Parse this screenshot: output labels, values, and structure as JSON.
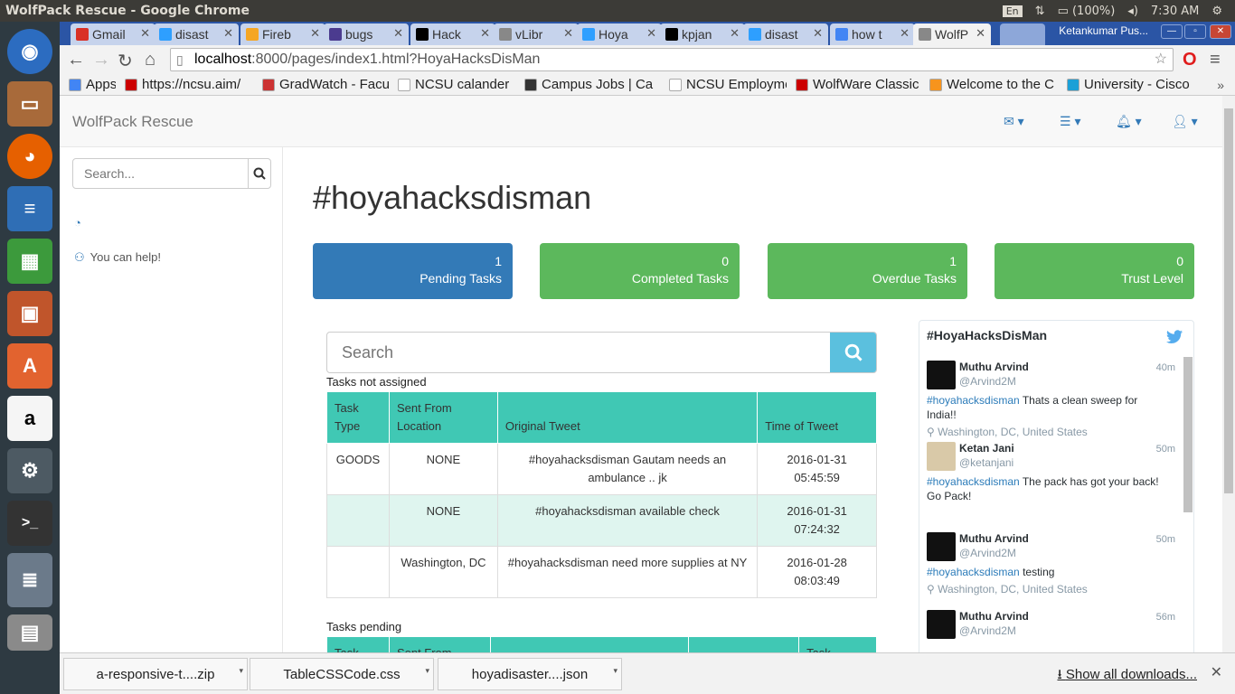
{
  "os": {
    "window_title": "WolfPack Rescue - Google Chrome",
    "keyboard": "En",
    "battery": "(100%)",
    "clock": "7:30 AM"
  },
  "browser": {
    "tabs": [
      {
        "label": "Gmail",
        "icon": "gmail-icon",
        "color": "#d93025"
      },
      {
        "label": "disast",
        "icon": "disqus-icon",
        "color": "#2e9fff"
      },
      {
        "label": "Fireb",
        "icon": "firebase-icon",
        "color": "#f5a623"
      },
      {
        "label": "bugs",
        "icon": "bugs-icon",
        "color": "#4b3b8f"
      },
      {
        "label": "Hack",
        "icon": "github-icon",
        "color": "#000000"
      },
      {
        "label": "vLibr",
        "icon": "page-icon",
        "color": "#888888"
      },
      {
        "label": "Hoya",
        "icon": "disqus-icon",
        "color": "#2e9fff"
      },
      {
        "label": "kpjan",
        "icon": "github-icon",
        "color": "#000000"
      },
      {
        "label": "disast",
        "icon": "disqus-icon",
        "color": "#2e9fff"
      },
      {
        "label": "how t",
        "icon": "google-icon",
        "color": "#4285f4"
      },
      {
        "label": "WolfP",
        "icon": "page-icon",
        "color": "#888888"
      }
    ],
    "profile_name": "Ketankumar Pus...",
    "url_host": "localhost",
    "url_rest": ":8000/pages/index1.html?HoyaHacksDisMan",
    "bookmarks": [
      {
        "label": "Apps",
        "color": "#4285f4"
      },
      {
        "label": "https://ncsu.aim/",
        "color": "#cc0000"
      },
      {
        "label": "GradWatch - Facu",
        "color": "#cc3333"
      },
      {
        "label": "NCSU calander",
        "color": "#ffffff"
      },
      {
        "label": "Campus Jobs | Ca",
        "color": "#333333"
      },
      {
        "label": "NCSU Employme",
        "color": "#ffffff"
      },
      {
        "label": "WolfWare Classic",
        "color": "#cc0000"
      },
      {
        "label": "Welcome to the C",
        "color": "#f7941d"
      },
      {
        "label": "University - Cisco",
        "color": "#1ba0d7"
      }
    ]
  },
  "app": {
    "brand": "WolfPack Rescue",
    "sidebar": {
      "search_placeholder": "Search...",
      "items": [
        {
          "label": "",
          "icon": "dashboard-icon"
        },
        {
          "label": "You can help!",
          "icon": "group-icon"
        }
      ]
    },
    "page_title": "#hoyahacksdisman",
    "panels": [
      {
        "value": "1",
        "label": "Pending Tasks",
        "color": "#337ab7"
      },
      {
        "value": "0",
        "label": "Completed Tasks",
        "color": "#5cb85c"
      },
      {
        "value": "1",
        "label": "Overdue Tasks",
        "color": "#5cb85c"
      },
      {
        "value": "0",
        "label": "Trust Level",
        "color": "#5cb85c"
      }
    ],
    "task_search_placeholder": "Search",
    "unassigned": {
      "caption": "Tasks not assigned",
      "headers": [
        "Task Type",
        "Sent From Location",
        "Original Tweet",
        "Time of Tweet"
      ],
      "rows": [
        [
          "GOODS",
          "NONE",
          "#hoyahacksdisman Gautam needs an ambulance .. jk",
          "2016-01-31 05:45:59"
        ],
        [
          "",
          "NONE",
          "#hoyahacksdisman available check",
          "2016-01-31 07:24:32"
        ],
        [
          "",
          "Washington, DC",
          "#hoyahacksdisman need more supplies at NY",
          "2016-01-28 08:03:49"
        ]
      ]
    },
    "pending": {
      "caption": "Tasks pending",
      "headers": [
        "Task",
        "Sent From",
        "",
        "",
        "Task"
      ]
    },
    "twitter": {
      "title": "#HoyaHacksDisMan",
      "tweets": [
        {
          "name": "Muthu Arvind",
          "handle": "@Arvind2M",
          "time": "40m",
          "hashtag": "#hoyahacksdisman",
          "text": " Thats a clean sweep for India!!",
          "location": "Washington, DC, United States"
        },
        {
          "name": "Ketan Jani",
          "handle": "@ketanjani",
          "time": "50m",
          "hashtag": "#hoyahacksdisman",
          "text": " The pack has got your back! Go Pack!",
          "location": ""
        },
        {
          "name": "Muthu Arvind",
          "handle": "@Arvind2M",
          "time": "50m",
          "hashtag": "#hoyahacksdisman",
          "text": " testing",
          "location": "Washington, DC, United States"
        },
        {
          "name": "Muthu Arvind",
          "handle": "@Arvind2M",
          "time": "56m",
          "hashtag": "",
          "text": "",
          "location": ""
        }
      ]
    }
  },
  "downloads": {
    "files": [
      "a-responsive-t....zip",
      "TableCSSCode.css",
      "hoyadisaster....json"
    ],
    "show_all": "Show all downloads..."
  }
}
